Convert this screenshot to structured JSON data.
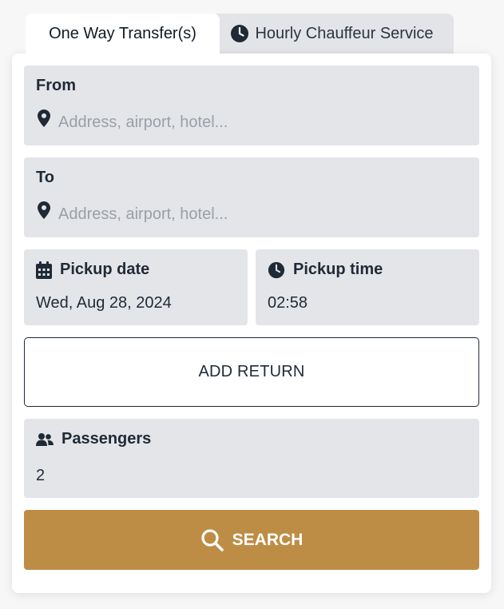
{
  "tabs": {
    "one_way": {
      "label": "One Way Transfer(s)",
      "active": true
    },
    "hourly": {
      "label": "Hourly Chauffeur Service",
      "icon": "clock-icon"
    }
  },
  "form": {
    "from": {
      "label": "From",
      "placeholder": "Address, airport, hotel...",
      "icon": "map-pin-icon"
    },
    "to": {
      "label": "To",
      "placeholder": "Address, airport, hotel...",
      "icon": "map-pin-icon"
    },
    "pickup_date": {
      "label": "Pickup date",
      "value": "Wed, Aug 28, 2024",
      "icon": "calendar-icon"
    },
    "pickup_time": {
      "label": "Pickup time",
      "value": "02:58",
      "icon": "clock-icon"
    },
    "add_return_label": "ADD RETURN",
    "passengers": {
      "label": "Passengers",
      "value": "2",
      "icon": "users-icon"
    },
    "search_label": "SEARCH"
  },
  "colors": {
    "accent": "#bd8d45",
    "field_bg": "#e4e5e9",
    "text": "#1f2a36",
    "placeholder": "#9aa0a8"
  }
}
